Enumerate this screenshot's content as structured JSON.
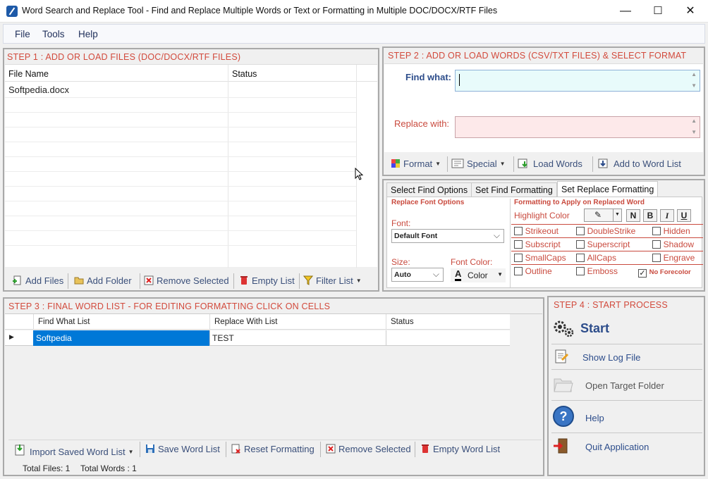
{
  "window": {
    "title": "Word Search and Replace Tool - Find and Replace Multiple Words or Text  or Formatting in Multiple DOC/DOCX/RTF Files",
    "minimize": "—",
    "maximize": "☐",
    "close": "✕"
  },
  "menu": {
    "file": "File",
    "tools": "Tools",
    "help": "Help"
  },
  "step1": {
    "title": "STEP 1 : ADD OR LOAD FILES (DOC/DOCX/RTF FILES)",
    "col_filename": "File Name",
    "col_status": "Status",
    "files": [
      {
        "name": "Softpedia.docx",
        "status": ""
      }
    ],
    "toolbar": {
      "add_files": "Add Files",
      "add_folder": "Add Folder",
      "remove_selected": "Remove Selected",
      "empty_list": "Empty List",
      "filter_list": "Filter List"
    }
  },
  "step2": {
    "title": "STEP 2 : ADD OR LOAD WORDS (CSV/TXT FILES) & SELECT FORMAT",
    "find_label": "Find what:",
    "replace_label": "Replace with:",
    "find_value": "",
    "replace_value": "",
    "toolbar": {
      "format": "Format",
      "special": "Special",
      "load_words": "Load Words",
      "add_to_word_list": "Add to Word List"
    }
  },
  "tabs": {
    "items": [
      "Select Find Options",
      "Set Find Formatting",
      "Set Replace Formatting"
    ],
    "active": "Set Replace Formatting"
  },
  "replace_font": {
    "group_title": "Replace Font Options",
    "font_label": "Font:",
    "font_value": "Default Font",
    "size_label": "Size:",
    "size_value": "Auto",
    "color_label": "Font Color:",
    "color_value": "Color"
  },
  "formatting": {
    "group_title": "Formatting to Apply on Replaced Word",
    "highlight_label": "Highlight Color",
    "bold": "N",
    "bold2": "B",
    "italic": "I",
    "underline": "U",
    "options": [
      {
        "label": "Strikeout",
        "checked": false
      },
      {
        "label": "DoubleStrike",
        "checked": false
      },
      {
        "label": "Hidden",
        "checked": false
      },
      {
        "label": "Subscript",
        "checked": false
      },
      {
        "label": "Superscript",
        "checked": false
      },
      {
        "label": "Shadow",
        "checked": false
      },
      {
        "label": "SmallCaps",
        "checked": false
      },
      {
        "label": "AllCaps",
        "checked": false
      },
      {
        "label": "Engrave",
        "checked": false
      },
      {
        "label": "Outline",
        "checked": false
      },
      {
        "label": "Emboss",
        "checked": false
      },
      {
        "label": "No Forecolor",
        "checked": true
      }
    ]
  },
  "step3": {
    "title": "STEP 3 : FINAL WORD LIST - FOR EDITING FORMATTING CLICK ON CELLS",
    "col_find": "Find What List",
    "col_replace": "Replace With List",
    "col_status": "Status",
    "rows": [
      {
        "find": "Softpedia",
        "replace": "TEST",
        "status": ""
      }
    ],
    "toolbar": {
      "import": "Import Saved Word List",
      "save": "Save Word List",
      "reset": "Reset Formatting",
      "remove": "Remove Selected",
      "empty": "Empty Word List"
    }
  },
  "step4": {
    "title": "STEP 4 : START PROCESS",
    "start": "Start",
    "show_log": "Show Log File",
    "open_target": "Open Target Folder",
    "help": "Help",
    "quit": "Quit Application"
  },
  "statusbar": {
    "total_files": "Total Files: 1",
    "total_words": "Total Words : 1"
  },
  "colors": {
    "accent_red": "#d24a3c",
    "selection_blue": "#0078d7",
    "find_bg": "#e8fbfb",
    "replace_bg": "#fde9ea"
  }
}
